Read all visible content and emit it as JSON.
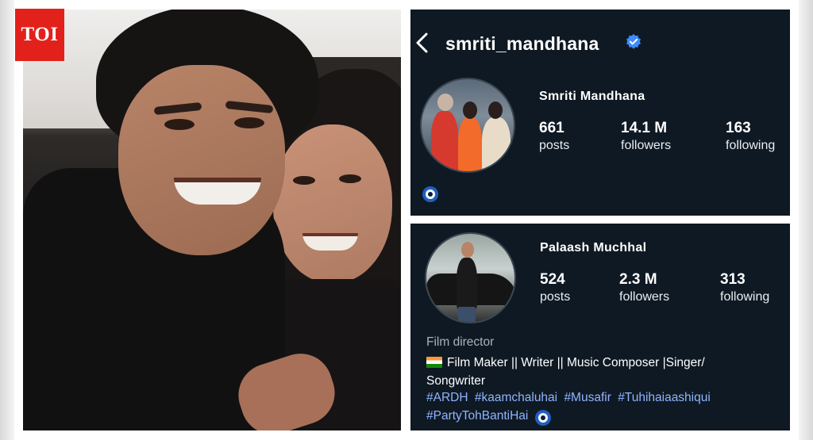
{
  "badge": {
    "text": "TOI"
  },
  "profile1": {
    "username": "smriti_mandhana",
    "full_name": "Smriti Mandhana",
    "stats": [
      {
        "value": "661",
        "label": "posts"
      },
      {
        "value": "14.1 M",
        "label": "followers"
      },
      {
        "value": "163",
        "label": "following"
      }
    ]
  },
  "profile2": {
    "full_name": "Palaash Muchhal",
    "stats": [
      {
        "value": "524",
        "label": "posts"
      },
      {
        "value": "2.3 M",
        "label": "followers"
      },
      {
        "value": "313",
        "label": "following"
      }
    ],
    "category": "Film director",
    "bio_line1": "Film Maker || Writer || Music Composer |Singer/",
    "bio_line2": "Songwriter",
    "hashtags": [
      "#ARDH",
      "#kaamchaluhai",
      "#Musafir",
      "#Tuhihaiaashiqui",
      "#PartyTohBantiHai"
    ]
  },
  "colors": {
    "panel_bg": "#0f1923",
    "verified": "#3d8bfd",
    "hashtag": "#8fb4ff",
    "toi_red": "#e3211b"
  },
  "icons": [
    "back-chevron-icon",
    "verified-badge-icon",
    "evil-eye-emoji-icon",
    "india-flag-emoji-icon"
  ]
}
